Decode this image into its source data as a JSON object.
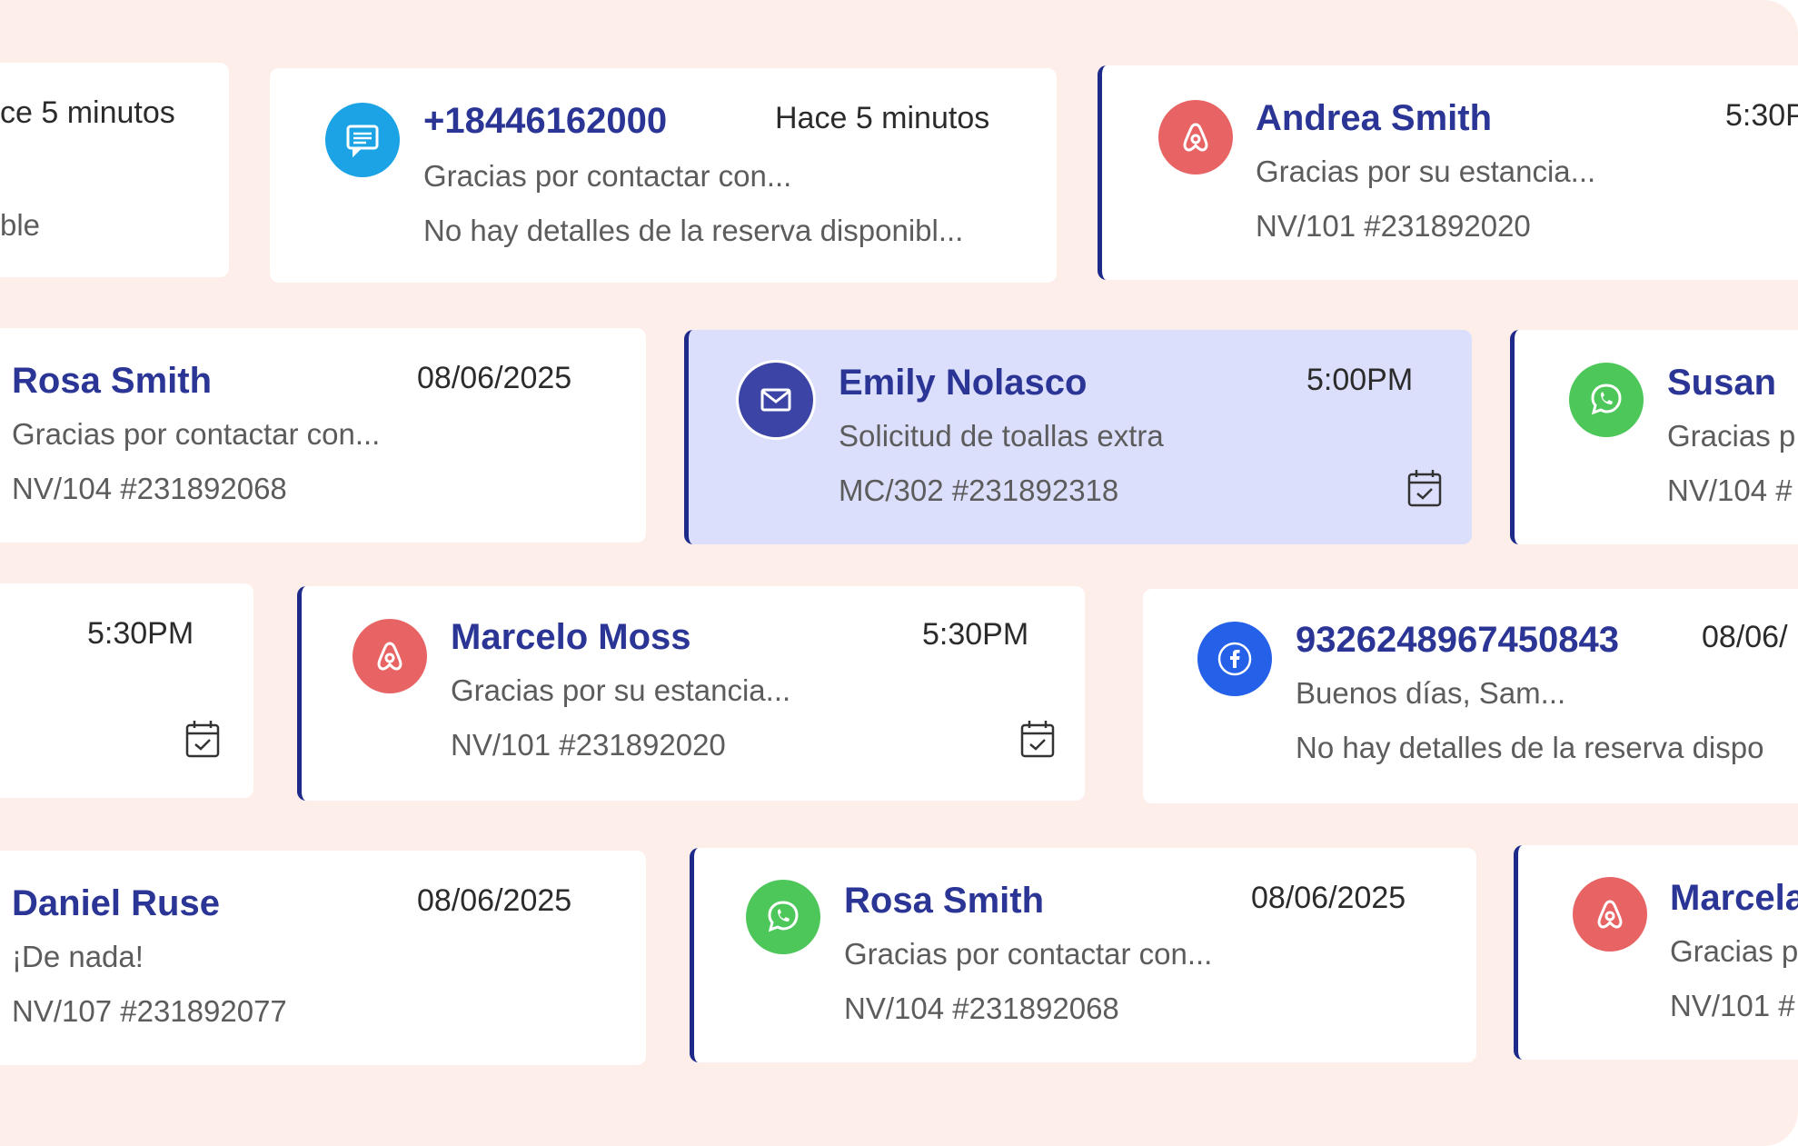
{
  "colors": {
    "background": "#fdeeea",
    "card": "#ffffff",
    "selected_card": "#dcdffb",
    "accent_bar": "#1e2a8a",
    "name": "#2b3595",
    "sms": "#1ba3e6",
    "airbnb": "#e86464",
    "email": "#3c45a5",
    "whatsapp": "#4dc65a",
    "facebook": "#2560e8"
  },
  "conversations": [
    {
      "time": "ce 5 minutos",
      "booking": "ble"
    },
    {
      "channel": "sms",
      "icon": "sms-chat-icon",
      "name": "+18446162000",
      "time": "Hace 5 minutos",
      "preview": "Gracias por contactar con...",
      "booking": "No hay detalles de la reserva disponibl..."
    },
    {
      "channel": "airbnb",
      "icon": "airbnb-icon",
      "name": "Andrea Smith",
      "time": "5:30P",
      "preview": "Gracias por su estancia...",
      "booking": "NV/101 #231892020"
    },
    {
      "name": "Rosa Smith",
      "time": "08/06/2025",
      "preview": "Gracias por contactar con...",
      "booking": "NV/104 #231892068"
    },
    {
      "channel": "email",
      "icon": "envelope-icon",
      "name": "Emily Nolasco",
      "time": "5:00PM",
      "preview": "Solicitud de toallas extra",
      "booking": "MC/302 #231892318",
      "selected": true
    },
    {
      "channel": "whatsapp",
      "icon": "whatsapp-icon",
      "name": "Susan",
      "preview": "Gracias p",
      "booking": "NV/104 #"
    },
    {
      "time": "5:30PM"
    },
    {
      "channel": "airbnb",
      "icon": "airbnb-icon",
      "name": "Marcelo Moss",
      "time": "5:30PM",
      "preview": "Gracias por su estancia...",
      "booking": "NV/101 #231892020"
    },
    {
      "channel": "facebook",
      "icon": "facebook-icon",
      "name": "9326248967450843",
      "time": "08/06/",
      "preview": "Buenos días, Sam...",
      "booking": "No hay detalles de la reserva dispo"
    },
    {
      "name": "Daniel Ruse",
      "time": "08/06/2025",
      "preview": "¡De nada!",
      "booking": "NV/107 #231892077"
    },
    {
      "channel": "whatsapp",
      "icon": "whatsapp-icon",
      "name": "Rosa Smith",
      "time": "08/06/2025",
      "preview": "Gracias por contactar con...",
      "booking": "NV/104 #231892068"
    },
    {
      "channel": "airbnb",
      "icon": "airbnb-icon",
      "name": "Marcela",
      "preview": "Gracias p",
      "booking": "NV/101 #"
    }
  ]
}
